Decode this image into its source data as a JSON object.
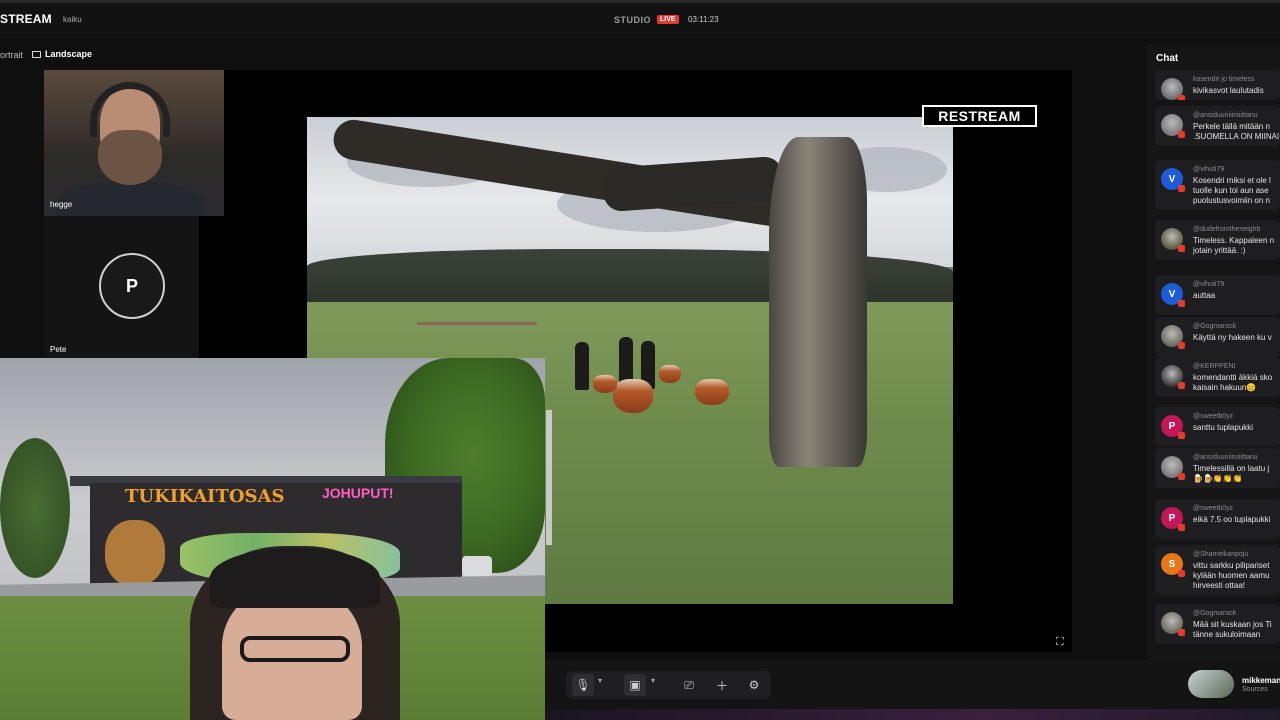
{
  "header": {
    "brand": "STREAM",
    "project": "kaiku",
    "studio_label": "STUDIO",
    "live_badge": "LIVE",
    "timer": "03:11:23"
  },
  "layout_tabs": {
    "portrait": "ortrait",
    "landscape": "Landscape"
  },
  "participants": [
    {
      "name": "hegge"
    },
    {
      "name": "Pete",
      "initial": "P"
    }
  ],
  "overlay": {
    "logo_text": "RESTREAM"
  },
  "toolbar": {
    "icons": [
      "microphone-icon",
      "camera-icon",
      "share-screen-icon",
      "plus-icon",
      "settings-icon"
    ]
  },
  "chat": {
    "title": "Chat",
    "messages": [
      {
        "user": "kosendri jo timeless",
        "text": "kivikasvot laulutadis",
        "avatar": "photo",
        "color": "#6d6d6d"
      },
      {
        "user": "@ansiduuniinsiittanu",
        "text": "Perkele tällä mitään n\n.SUOMELLA ON MIINAI",
        "avatar": "photo",
        "color": "#7a7a7a"
      },
      {
        "user": "@vihuti79",
        "text": "Kosendri miksi et ole l\ntuolle kun toi aun ase\npuolustusvoimiin on n",
        "avatar": "V",
        "color": "#1e5bd6"
      },
      {
        "user": "@dudefromtheneighb",
        "text": "Timeless. Kappaleen n\njotain yrittää. :)",
        "avatar": "photo",
        "color": "#5c5a3c"
      },
      {
        "user": "@vihuti79",
        "text": "auttaa",
        "avatar": "V",
        "color": "#1e5bd6"
      },
      {
        "user": "@Gogmarock",
        "text": "Käyttä ny hakeen ku v",
        "avatar": "photo",
        "color": "#6a6a5a"
      },
      {
        "user": "@KERPPENI",
        "text": "komendantti äkkiä sko\nkaisain hakuun😊",
        "avatar": "photo",
        "color": "#3a3a3a"
      },
      {
        "user": "@sweetb0yz",
        "text": "santtu tuplapukki",
        "avatar": "P",
        "color": "#c2185b"
      },
      {
        "user": "@ansiduuniinsiittanu",
        "text": "Timelessillä on laatu j\n🍺🍺👏👏👏",
        "avatar": "photo",
        "color": "#7a7a7a"
      },
      {
        "user": "@sweetb0yz",
        "text": "eikä 7.5 oo tuplapukki",
        "avatar": "P",
        "color": "#c2185b"
      },
      {
        "user": "@Shameikanpoju",
        "text": "vittu sarkku pilipariset\nkylään huomen aamu\nhirveesti ottaa!",
        "avatar": "S",
        "color": "#e87817"
      },
      {
        "user": "@Gogmarock",
        "text": "Mää sit kuskaan jos Ti\ntänne sukuloimaan",
        "avatar": "photo",
        "color": "#6a6a5a"
      }
    ]
  },
  "account": {
    "name": "mikkeman",
    "sub": "Sources"
  }
}
